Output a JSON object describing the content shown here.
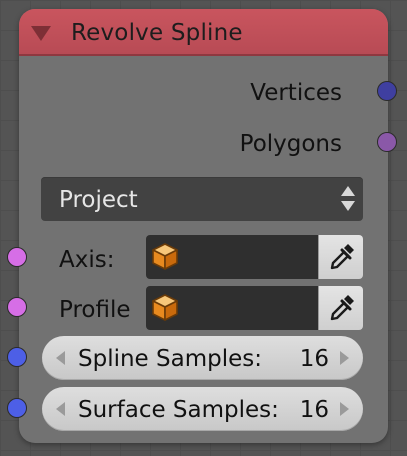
{
  "node": {
    "title": "Revolve Spline",
    "header_color": "#c9555e",
    "body_color": "#727272"
  },
  "outputs": [
    {
      "label": "Vertices",
      "socket_color": "#3f3fa0"
    },
    {
      "label": "Polygons",
      "socket_color": "#8a58a8"
    }
  ],
  "mode_dropdown": {
    "selected": "Project"
  },
  "inputs": {
    "axis": {
      "label": "Axis:",
      "socket_color": "#d66ee6",
      "icon": "cube-icon"
    },
    "profile": {
      "label": "Profile",
      "socket_color": "#d66ee6",
      "icon": "cube-icon"
    },
    "spline_samples": {
      "label": "Spline Samples:",
      "value": "16",
      "socket_color": "#4d5fe6"
    },
    "surface_samples": {
      "label": "Surface Samples:",
      "value": "16",
      "socket_color": "#4d5fe6"
    }
  },
  "icons": {
    "picker": "eyedropper-icon",
    "collapse": "collapse-triangle-icon"
  }
}
